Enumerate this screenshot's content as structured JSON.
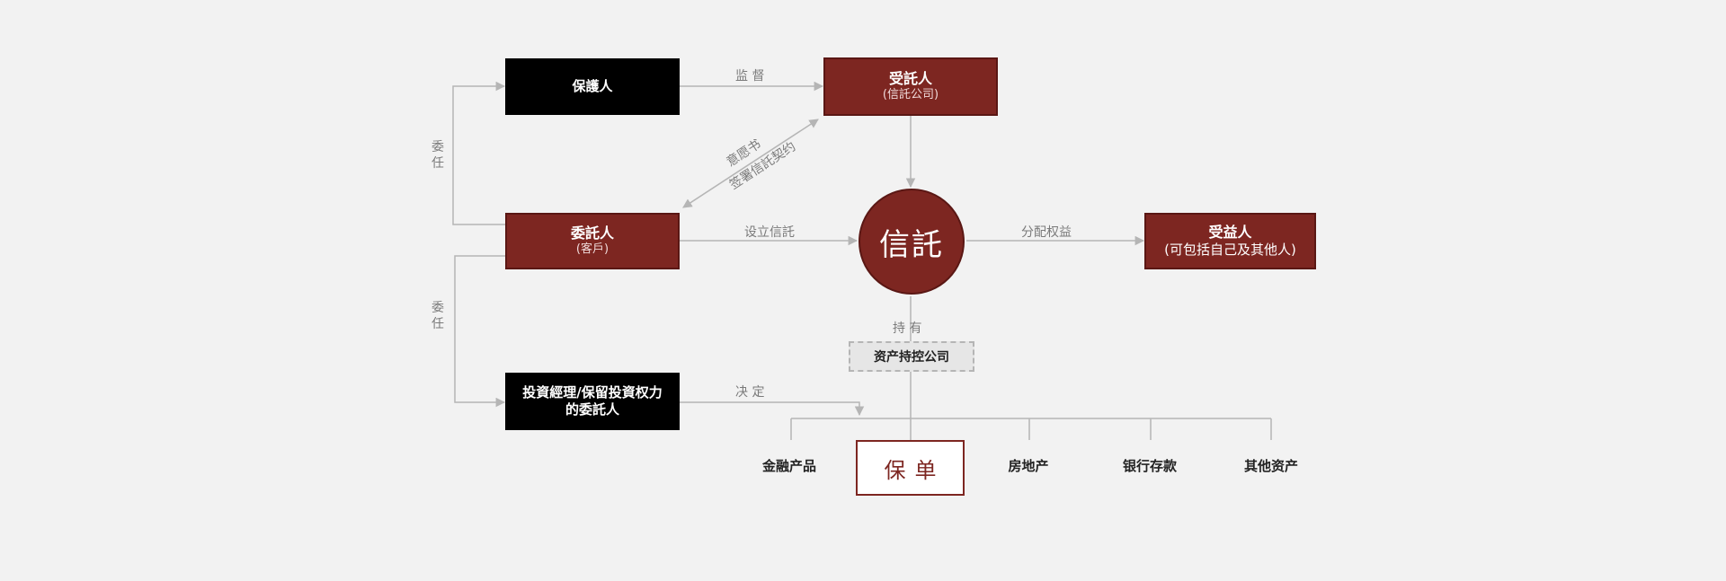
{
  "nodes": {
    "guardian": {
      "label": "保護人"
    },
    "trustee": {
      "label": "受託人",
      "sub": "(信託公司)"
    },
    "settlor": {
      "label": "委託人",
      "sub": "(客戶)"
    },
    "trust": {
      "label": "信託"
    },
    "beneficiary": {
      "label": "受益人",
      "sub": "(可包括自己及其他人)"
    },
    "investment_manager": {
      "label": "投資經理/保留投資权力的委託人"
    },
    "holding_company": {
      "label": "资产持控公司"
    },
    "policy": {
      "label": "保单"
    }
  },
  "edge_labels": {
    "supervise": "监 督",
    "letter_of_wishes": "意愿书",
    "sign_trust_deed": "签署信託契约",
    "appoint_top": "委任",
    "appoint_bottom": "委任",
    "establish_trust": "设立信託",
    "distribute_rights": "分配权益",
    "hold": "持 有",
    "decide": "决 定"
  },
  "assets": [
    "金融产品",
    "房地产",
    "银行存款",
    "其他资产"
  ],
  "colors": {
    "accent": "#7d2621",
    "dark": "#000000",
    "line": "#b5b5b5",
    "background": "#f2f2f2"
  }
}
